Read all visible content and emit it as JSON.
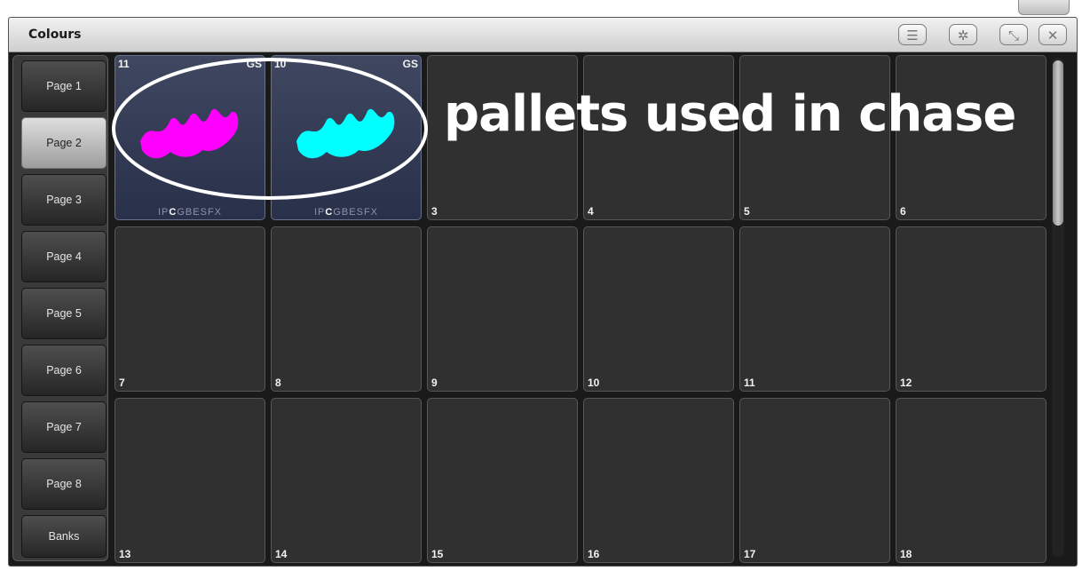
{
  "window": {
    "title": "Colours"
  },
  "titlebar_buttons": [
    {
      "name": "menu-button",
      "icon": "list-icon",
      "glyph": "☰"
    },
    {
      "name": "settings-button",
      "icon": "gear-icon",
      "glyph": "✲"
    },
    {
      "name": "resize-button",
      "icon": "resize-icon",
      "glyph": "⤡"
    },
    {
      "name": "close-button",
      "icon": "close-icon",
      "glyph": "✕"
    }
  ],
  "sidebar": {
    "selected": "Page 2",
    "items": [
      "Page 1",
      "Page 2",
      "Page 3",
      "Page 4",
      "Page 5",
      "Page 6",
      "Page 7",
      "Page 8",
      "Banks"
    ]
  },
  "palettes": [
    {
      "number": "11",
      "tag": "GS",
      "attributes": [
        "I",
        "P",
        "C",
        "G",
        "B",
        "E",
        "S",
        "FX"
      ],
      "active_attribute": "C",
      "swatch_color": "#ff00ff"
    },
    {
      "number": "10",
      "tag": "GS",
      "attributes": [
        "I",
        "P",
        "C",
        "G",
        "B",
        "E",
        "S",
        "FX"
      ],
      "active_attribute": "C",
      "swatch_color": "#00ffff"
    }
  ],
  "grid_labels": [
    "3",
    "4",
    "5",
    "6",
    "7",
    "8",
    "9",
    "10",
    "11",
    "12",
    "13",
    "14",
    "15",
    "16",
    "17",
    "18"
  ],
  "annotation": "pallets used in chase",
  "colors": {
    "cell_bg": "#303030",
    "active_cell_bg": "#343b55",
    "annotation": "#ffffff"
  }
}
